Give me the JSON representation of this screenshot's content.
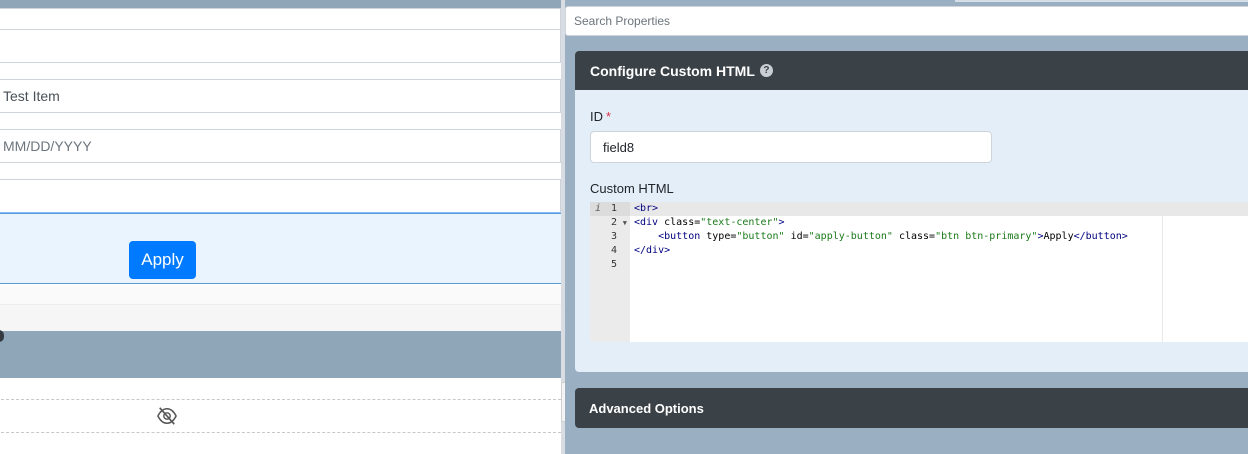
{
  "form": {
    "field_test_item": "Test Item",
    "field_date_placeholder": "MM/DD/YYYY",
    "apply_label": "Apply"
  },
  "panel": {
    "search_placeholder": "Search Properties",
    "card_title": "Configure Custom HTML",
    "help_glyph": "?",
    "id_label": "ID",
    "required_mark": "*",
    "id_value": "field8",
    "custom_html_label": "Custom HTML",
    "advanced_title": "Advanced Options"
  },
  "editor": {
    "line_numbers": [
      "1",
      "2",
      "3",
      "4",
      "5"
    ],
    "code": {
      "l1": "<br>",
      "l2_tag_open": "<div",
      "l2_attr": " class=",
      "l2_str": "\"text-center\"",
      "l2_tag_close": ">",
      "l3_indent": "    ",
      "l3_tag_open": "<button",
      "l3_attr1": " type=",
      "l3_str1": "\"button\"",
      "l3_attr2": " id=",
      "l3_str2": "\"apply-button\"",
      "l3_attr3": " class=",
      "l3_str3": "\"btn btn-primary\"",
      "l3_tag_gt": ">",
      "l3_text": "Apply",
      "l3_tag_end": "</button>",
      "l4": "</div>"
    }
  },
  "icons": {
    "hidden": "eye-slash-icon",
    "help": "question-circle-icon",
    "info": "info-icon",
    "fold": "fold-arrow-icon"
  },
  "colors": {
    "primary": "#007bff",
    "header_dark": "#3b4247",
    "panel_bg": "#9aafc1",
    "card_bg": "#e3eef9",
    "required": "#dc3545"
  }
}
